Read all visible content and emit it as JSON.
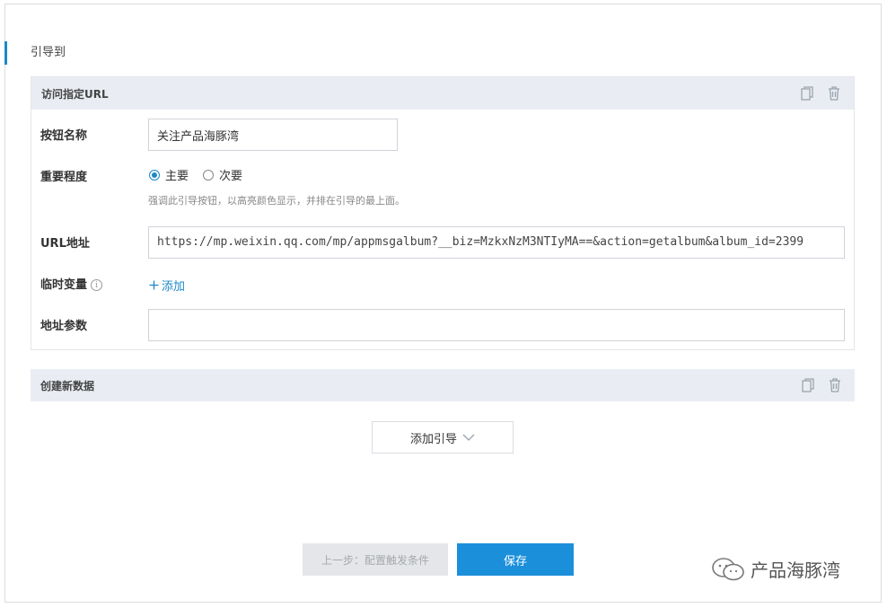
{
  "section": {
    "title": "引导到"
  },
  "card1": {
    "title": "访问指定URL",
    "copy_icon": "copy-icon",
    "delete_icon": "trash-icon",
    "button_name": {
      "label": "按钮名称",
      "value": "关注产品海豚湾"
    },
    "importance": {
      "label": "重要程度",
      "options": [
        {
          "label": "主要",
          "checked": true
        },
        {
          "label": "次要",
          "checked": false
        }
      ],
      "hint": "强调此引导按钮，以高亮颜色显示，并排在引导的最上面。"
    },
    "url": {
      "label": "URL地址",
      "value": "https://mp.weixin.qq.com/mp/appmsgalbum?__biz=MzkxNzM3NTIyMA==&action=getalbum&album_id=2399"
    },
    "temp_vars": {
      "label": "临时变量",
      "info_icon": "ⓘ",
      "add_label": "添加"
    },
    "params": {
      "label": "地址参数",
      "value": ""
    }
  },
  "card2": {
    "title": "创建新数据",
    "copy_icon": "copy-icon",
    "delete_icon": "trash-icon"
  },
  "add_guide": {
    "label": "添加引导"
  },
  "footer": {
    "prev_label": "上一步：配置触发条件",
    "save_label": "保存"
  },
  "watermark": {
    "text": "产品海豚湾"
  },
  "colors": {
    "accent": "#1c8fdb",
    "card_header": "#e9edf3"
  }
}
